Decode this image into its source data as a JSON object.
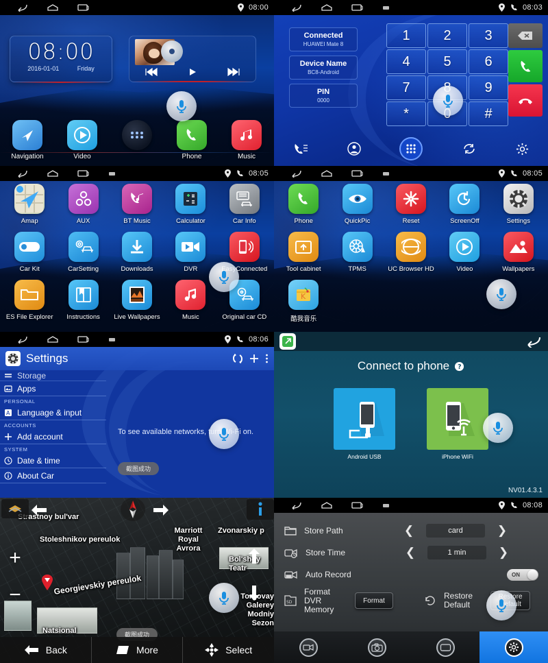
{
  "panels": {
    "home": {
      "statusbar": {
        "time": "08:00",
        "icons": [
          "back-icon",
          "home-icon",
          "recents-icon",
          "location-icon"
        ]
      },
      "clock_widget": {
        "time": "08:00",
        "date": "2016-01-01",
        "weekday": "Friday"
      },
      "media_widget": {
        "prev": "prev-track-icon",
        "play": "play-icon",
        "next": "next-track-icon"
      },
      "dock": [
        {
          "label": "Navigation",
          "icon": "navigation-icon",
          "color": "#3ea4f0"
        },
        {
          "label": "Video",
          "icon": "video-play-icon",
          "color": "#2bb6ef"
        },
        {
          "label": "",
          "icon": "app-drawer-icon",
          "color": "#1b2436"
        },
        {
          "label": "Phone",
          "icon": "phone-icon",
          "color": "#4cbd3a"
        },
        {
          "label": "Music",
          "icon": "music-note-icon",
          "color": "#f0404f"
        }
      ]
    },
    "dialer": {
      "statusbar": {
        "time": "08:03"
      },
      "info": [
        {
          "title": "Connected",
          "sub": "HUAWEI Mate 8"
        },
        {
          "title": "Device Name",
          "sub": "BC8-Android"
        },
        {
          "title": "PIN",
          "sub": "0000"
        }
      ],
      "keys": [
        "1",
        "2",
        "3",
        "4",
        "5",
        "6",
        "7",
        "8",
        "9",
        "*",
        "0",
        "#"
      ],
      "actions": {
        "delete": "backspace-icon",
        "call": "call-icon",
        "hangup": "hangup-icon"
      },
      "bottom_tabs": [
        "call-log-icon",
        "contacts-icon",
        "keypad-icon",
        "sync-icon",
        "settings-icon"
      ]
    },
    "apps_page1": {
      "statusbar": {
        "time": "08:05"
      },
      "apps": [
        {
          "label": "Amap",
          "icon": "map-arrow-icon",
          "color": "#e8e2d0"
        },
        {
          "label": "AUX",
          "icon": "aux-circles-icon",
          "color": "#b24fc0"
        },
        {
          "label": "BT Music",
          "icon": "bt-music-icon",
          "color": "#c4449f"
        },
        {
          "label": "Calculator",
          "icon": "calculator-icon",
          "color": "#2fa8ee"
        },
        {
          "label": "Car Info",
          "icon": "car-info-icon",
          "color": "#8f9499"
        },
        {
          "label": "Car Kit",
          "icon": "car-kit-toggle-icon",
          "color": "#2fa8ee"
        },
        {
          "label": "CarSetting",
          "icon": "car-gear-icon",
          "color": "#2fa8ee"
        },
        {
          "label": "Downloads",
          "icon": "download-icon",
          "color": "#2fa8ee"
        },
        {
          "label": "DVR",
          "icon": "dvr-camera-icon",
          "color": "#2fa8ee"
        },
        {
          "label": "EasyConnected",
          "icon": "phone-cast-icon",
          "color": "#ef3b42"
        },
        {
          "label": "ES File Explorer",
          "icon": "folder-icon",
          "color": "#f0a428"
        },
        {
          "label": "Instructions",
          "icon": "book-icon",
          "color": "#2fa8ee"
        },
        {
          "label": "Live Wallpapers",
          "icon": "live-wallpaper-icon",
          "color": "#2fa8ee"
        },
        {
          "label": "Music",
          "icon": "music-note-icon",
          "color": "#f0404f"
        },
        {
          "label": "Original car CD",
          "icon": "original-cd-icon",
          "color": "#2fa8ee"
        }
      ]
    },
    "apps_page2": {
      "statusbar": {
        "time": "08:05"
      },
      "apps": [
        {
          "label": "Phone",
          "icon": "phone-icon",
          "color": "#4cbd3a"
        },
        {
          "label": "QuickPic",
          "icon": "eye-icon",
          "color": "#2fa8ee"
        },
        {
          "label": "Reset",
          "icon": "reset-star-icon",
          "color": "#ef3b42"
        },
        {
          "label": "ScreenOff",
          "icon": "clock-off-icon",
          "color": "#2fa8ee"
        },
        {
          "label": "Settings",
          "icon": "gear-icon",
          "color": "#d8d8d8"
        },
        {
          "label": "Tool cabinet",
          "icon": "toolbox-icon",
          "color": "#f0a428"
        },
        {
          "label": "TPMS",
          "icon": "tpms-tire-icon",
          "color": "#2fa8ee"
        },
        {
          "label": "UC Browser HD",
          "icon": "globe-icon",
          "color": "#f0a428"
        },
        {
          "label": "Video",
          "icon": "video-play-icon",
          "color": "#2fa8ee"
        },
        {
          "label": "Wallpapers",
          "icon": "image-icon",
          "color": "#ef3b42"
        },
        {
          "label": "酷我音乐",
          "icon": "kuwo-music-icon",
          "color": "#5bc0f0"
        }
      ]
    },
    "settings": {
      "statusbar": {
        "time": "08:06"
      },
      "title": "Settings",
      "actions": [
        "sync-icon",
        "add-icon",
        "overflow-icon"
      ],
      "rows": [
        {
          "type": "item",
          "label": "Storage",
          "icon": "storage-icon"
        },
        {
          "type": "item",
          "label": "Apps",
          "icon": "apps-icon"
        },
        {
          "type": "header",
          "label": "PERSONAL"
        },
        {
          "type": "item",
          "label": "Language & input",
          "icon": "language-icon"
        },
        {
          "type": "header",
          "label": "ACCOUNTS"
        },
        {
          "type": "item",
          "label": "Add account",
          "icon": "plus-icon"
        },
        {
          "type": "header",
          "label": "SYSTEM"
        },
        {
          "type": "item",
          "label": "Date & time",
          "icon": "clock-icon"
        },
        {
          "type": "item",
          "label": "About Car",
          "icon": "info-icon"
        }
      ],
      "hint": "To see available networks, turn Wi-Fi on.",
      "toast": "截图成功"
    },
    "mirror": {
      "title": "Connect to phone",
      "help_icon": "help-icon",
      "back_icon": "back-icon",
      "app_icon": "screen-mirror-icon",
      "cards": [
        {
          "label": "Android USB",
          "icon": "android-usb-icon",
          "color": "#21a3e0"
        },
        {
          "label": "iPhone WiFi",
          "icon": "iphone-wifi-icon",
          "color": "#7cc04c"
        }
      ],
      "version": "NV01.4.3.1"
    },
    "map": {
      "labels": [
        "Strastnoy bul'var",
        "Stoleshnikov pereulok",
        "Marriott Royal Avrora",
        "Zvonarskiy p",
        "Bol'shoy Teatr",
        "Georgievskiy pereulok",
        "Torgovay Galerey Modniy Sezon",
        "Natsional"
      ],
      "controls": {
        "zoom_in": "+",
        "zoom_out": "−",
        "left": "left-arrow-icon",
        "right": "right-arrow-icon",
        "compass": "compass-icon",
        "info": "info-icon",
        "layers": "layers-icon"
      },
      "toast": "截图成功",
      "bottom": [
        {
          "label": "Back",
          "icon": "back-arrow-icon"
        },
        {
          "label": "More",
          "icon": "more-icon"
        },
        {
          "label": "Select",
          "icon": "select-crosshair-icon"
        }
      ]
    },
    "dvr": {
      "statusbar": {
        "time": "08:08"
      },
      "rows": [
        {
          "label": "Store Path",
          "icon": "folder-icon",
          "value": "card",
          "control": "stepper"
        },
        {
          "label": "Store Time",
          "icon": "video-clock-icon",
          "value": "1 min",
          "control": "stepper"
        },
        {
          "label": "Auto Record",
          "icon": "video-record-icon",
          "value": "ON",
          "control": "toggle"
        }
      ],
      "format": {
        "label": "Format DVR Memory",
        "icon": "sd-format-icon",
        "button": "Format"
      },
      "restore": {
        "label": "Restore Default",
        "icon": "restore-icon",
        "button": "Restore Default"
      },
      "tabs": [
        "video-icon",
        "camera-icon",
        "gallery-icon",
        "settings-icon"
      ],
      "active_tab": 3
    }
  }
}
